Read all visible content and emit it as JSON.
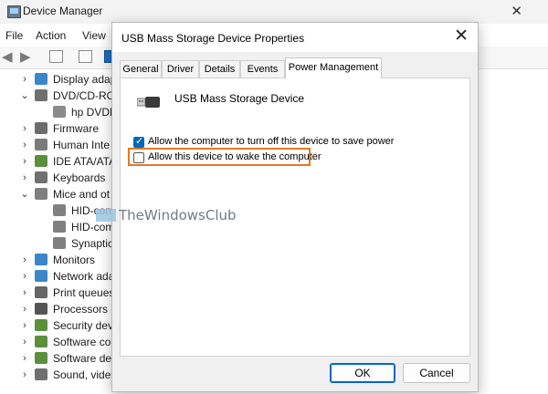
{
  "device_manager": {
    "title": "Device Manager",
    "menu": [
      "File",
      "Action",
      "View"
    ],
    "tree": [
      {
        "label": "Display adap",
        "level": 1,
        "expanded": false,
        "icon": "display-icon",
        "color": "#3a86c8"
      },
      {
        "label": "DVD/CD-RO",
        "level": 1,
        "expanded": true,
        "icon": "dvd-drive-icon",
        "color": "#6f6f6f"
      },
      {
        "label": "hp DVDR",
        "level": 2,
        "expanded": null,
        "icon": "disc-drive-icon",
        "color": "#8b8b8b"
      },
      {
        "label": "Firmware",
        "level": 1,
        "expanded": false,
        "icon": "firmware-icon",
        "color": "#6c6c6c"
      },
      {
        "label": "Human Inte",
        "level": 1,
        "expanded": false,
        "icon": "hid-icon",
        "color": "#7b7b7b"
      },
      {
        "label": "IDE ATA/ATA",
        "level": 1,
        "expanded": false,
        "icon": "ide-controller-icon",
        "color": "#5b8f3c"
      },
      {
        "label": "Keyboards",
        "level": 1,
        "expanded": false,
        "icon": "keyboard-icon",
        "color": "#707070"
      },
      {
        "label": "Mice and ot",
        "level": 1,
        "expanded": true,
        "icon": "mouse-icon",
        "color": "#808080"
      },
      {
        "label": "HID-com",
        "level": 2,
        "expanded": null,
        "icon": "mouse-icon",
        "color": "#808080"
      },
      {
        "label": "HID-com",
        "level": 2,
        "expanded": null,
        "icon": "mouse-icon",
        "color": "#808080"
      },
      {
        "label": "Synaptic",
        "level": 2,
        "expanded": null,
        "icon": "mouse-icon",
        "color": "#808080"
      },
      {
        "label": "Monitors",
        "level": 1,
        "expanded": false,
        "icon": "monitor-icon",
        "color": "#3a86c8"
      },
      {
        "label": "Network ada",
        "level": 1,
        "expanded": false,
        "icon": "network-adapter-icon",
        "color": "#3a86c8"
      },
      {
        "label": "Print queues",
        "level": 1,
        "expanded": false,
        "icon": "printer-icon",
        "color": "#666666"
      },
      {
        "label": "Processors",
        "level": 1,
        "expanded": false,
        "icon": "processor-icon",
        "color": "#555555"
      },
      {
        "label": "Security dev",
        "level": 1,
        "expanded": false,
        "icon": "security-device-icon",
        "color": "#5b8f3c"
      },
      {
        "label": "Software co",
        "level": 1,
        "expanded": false,
        "icon": "software-component-icon",
        "color": "#5b8f3c"
      },
      {
        "label": "Software dev",
        "level": 1,
        "expanded": false,
        "icon": "software-device-icon",
        "color": "#5b8f3c"
      },
      {
        "label": "Sound, vide",
        "level": 1,
        "expanded": false,
        "icon": "speaker-icon",
        "color": "#707070"
      }
    ]
  },
  "dialog": {
    "title": "USB Mass Storage Device Properties",
    "close_glyph": "✕",
    "tabs": [
      {
        "label": "General",
        "active": false
      },
      {
        "label": "Driver",
        "active": false
      },
      {
        "label": "Details",
        "active": false
      },
      {
        "label": "Events",
        "active": false
      },
      {
        "label": "Power Management",
        "active": true
      }
    ],
    "device_name": "USB Mass Storage Device",
    "options": [
      {
        "label": "Allow the computer to turn off this device to save power",
        "checked": true
      },
      {
        "label": "Allow this device to wake the computer",
        "checked": false,
        "highlighted": true
      }
    ],
    "buttons": {
      "ok": "OK",
      "cancel": "Cancel"
    }
  },
  "watermark": "TheWindowsClub",
  "colors": {
    "accent": "#0067c0",
    "highlight_box": "#e07b22"
  }
}
